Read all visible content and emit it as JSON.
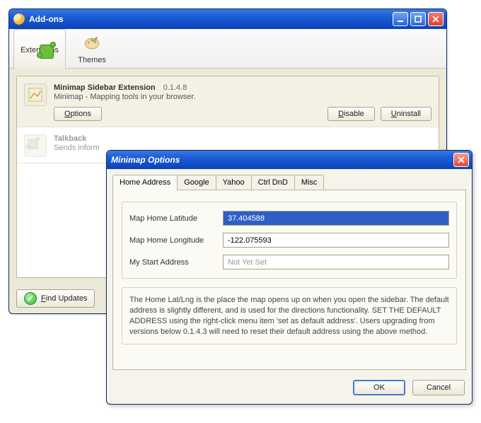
{
  "addons": {
    "title": "Add-ons",
    "tabs": {
      "extensions": "Extensions",
      "themes": "Themes"
    },
    "items": [
      {
        "name": "Minimap Sidebar Extension",
        "version": "0.1.4.8",
        "desc": "Minimap - Mapping tools in your browser.",
        "options_label": "Options",
        "disable_label": "Disable",
        "uninstall_label": "Uninstall"
      },
      {
        "name": "Talkback",
        "desc": "Sends inform"
      }
    ],
    "find_updates": "Find Updates"
  },
  "options": {
    "title": "Minimap Options",
    "tabs": [
      "Home Address",
      "Google",
      "Yahoo",
      "Ctrl DnD",
      "Misc"
    ],
    "fields": {
      "lat_label": "Map Home Latitude",
      "lat_value": "37.404588",
      "lng_label": "Map Home Longitude",
      "lng_value": "-122.075593",
      "start_label": "My Start Address",
      "start_value": "Not Yet Set"
    },
    "help": "The Home Lat/Lng is the place the map opens up on when you open the sidebar. The default address is slightly different, and is used for the directions functionality. SET THE DEFAULT ADDRESS using the right-click menu item 'set as default address'. Users upgrading from versions below 0.1.4.3 will need to reset their default address using the above method.",
    "ok": "OK",
    "cancel": "Cancel"
  }
}
